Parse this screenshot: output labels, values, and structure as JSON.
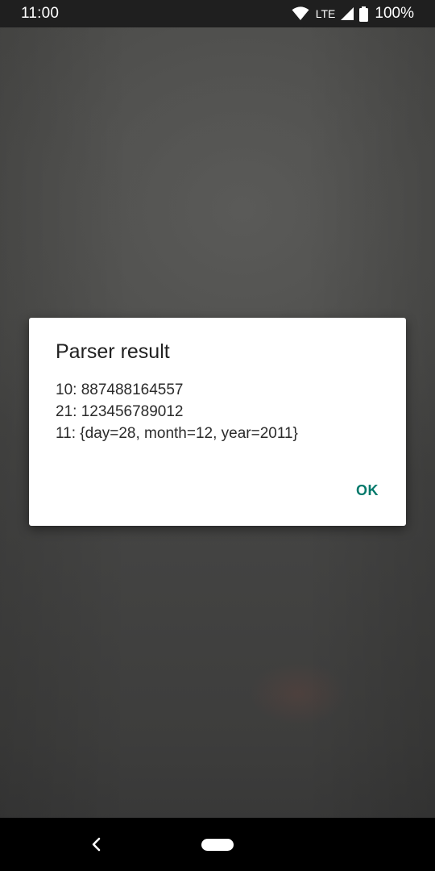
{
  "status_bar": {
    "time": "11:00",
    "network": "LTE",
    "battery": "100%",
    "icons": [
      "wifi-icon",
      "signal-icon",
      "battery-icon"
    ]
  },
  "dialog": {
    "title": "Parser result",
    "lines": [
      "10: 887488164557",
      "21: 123456789012",
      "11: {day=28, month=12, year=2011}"
    ],
    "ok_label": "OK"
  },
  "nav_bar": {
    "icons": [
      "back-icon",
      "home-pill"
    ]
  },
  "colors": {
    "accent": "#00796b",
    "status_bar": "#1f1f1f",
    "nav_bar": "#000000",
    "dialog_bg": "#ffffff"
  }
}
